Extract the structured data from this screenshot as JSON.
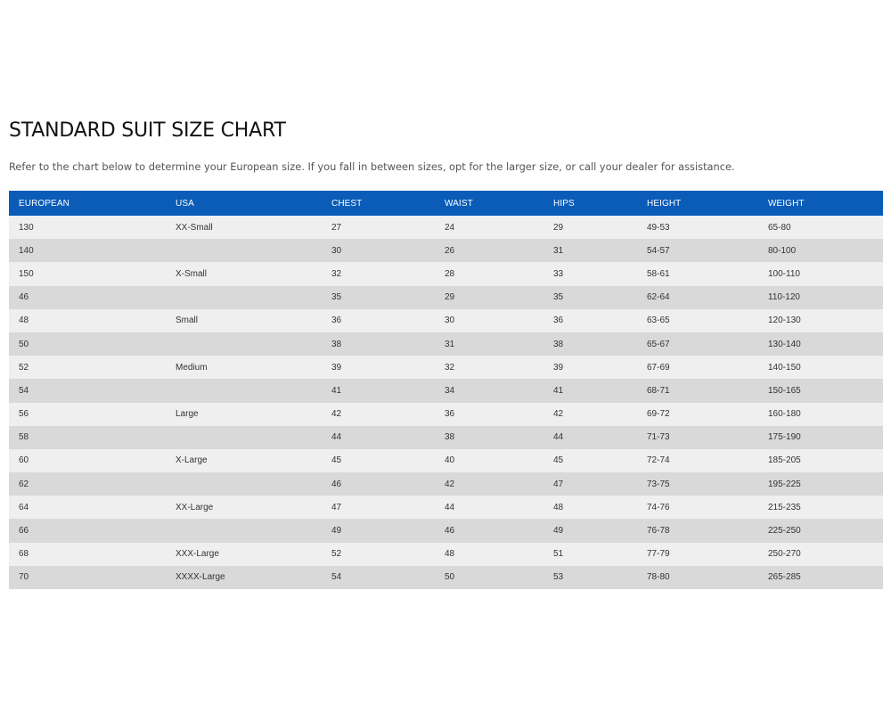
{
  "page": {
    "title": "STANDARD SUIT SIZE CHART",
    "intro": "Refer to the chart below to determine your European size. If you fall in between sizes, opt for the larger size, or call your dealer for assistance."
  },
  "table": {
    "headers": [
      "EUROPEAN",
      "USA",
      "CHEST",
      "WAIST",
      "HIPS",
      "HEIGHT",
      "WEIGHT"
    ],
    "rows": [
      [
        "130",
        "XX-Small",
        "27",
        "24",
        "29",
        "49-53",
        "65-80"
      ],
      [
        "140",
        "",
        "30",
        "26",
        "31",
        "54-57",
        "80-100"
      ],
      [
        "150",
        "X-Small",
        "32",
        "28",
        "33",
        "58-61",
        "100-110"
      ],
      [
        "46",
        "",
        "35",
        "29",
        "35",
        "62-64",
        "110-120"
      ],
      [
        "48",
        "Small",
        "36",
        "30",
        "36",
        "63-65",
        "120-130"
      ],
      [
        "50",
        "",
        "38",
        "31",
        "38",
        "65-67",
        "130-140"
      ],
      [
        "52",
        "Medium",
        "39",
        "32",
        "39",
        "67-69",
        "140-150"
      ],
      [
        "54",
        "",
        "41",
        "34",
        "41",
        "68-71",
        "150-165"
      ],
      [
        "56",
        "Large",
        "42",
        "36",
        "42",
        "69-72",
        "160-180"
      ],
      [
        "58",
        "",
        "44",
        "38",
        "44",
        "71-73",
        "175-190"
      ],
      [
        "60",
        "X-Large",
        "45",
        "40",
        "45",
        "72-74",
        "185-205"
      ],
      [
        "62",
        "",
        "46",
        "42",
        "47",
        "73-75",
        "195-225"
      ],
      [
        "64",
        "XX-Large",
        "47",
        "44",
        "48",
        "74-76",
        "215-235"
      ],
      [
        "66",
        "",
        "49",
        "46",
        "49",
        "76-78",
        "225-250"
      ],
      [
        "68",
        "XXX-Large",
        "52",
        "48",
        "51",
        "77-79",
        "250-270"
      ],
      [
        "70",
        "XXXX-Large",
        "54",
        "50",
        "53",
        "78-80",
        "265-285"
      ]
    ]
  },
  "colors": {
    "header_background": "#0a5cb8",
    "row_light": "#efefef",
    "row_dark": "#d9d9d9"
  }
}
